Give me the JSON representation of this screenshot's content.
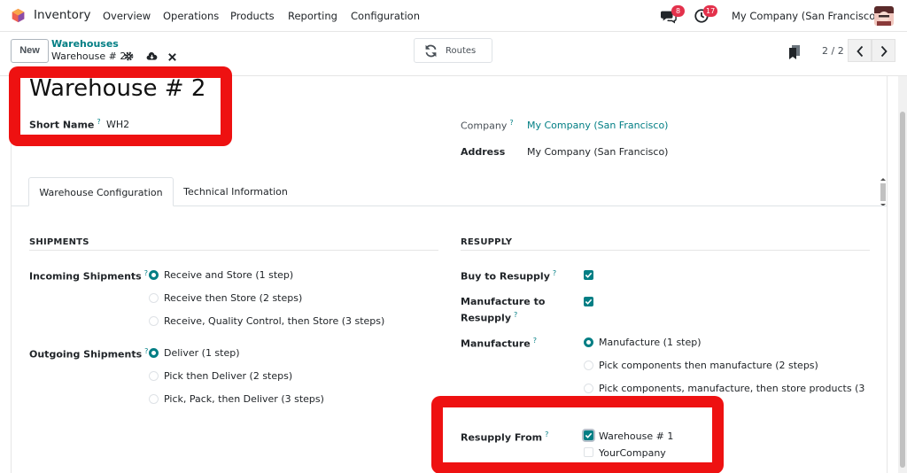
{
  "navbar": {
    "app_name": "Inventory",
    "menu": [
      "Overview",
      "Operations",
      "Products",
      "Reporting",
      "Configuration"
    ],
    "messages_count": "8",
    "activities_count": "17",
    "company": "My Company (San Francisco)"
  },
  "control_panel": {
    "new_label": "New",
    "breadcrumb_parent": "Warehouses",
    "breadcrumb_current": "Warehouse # 2",
    "routes_label": "Routes",
    "pager": "2 / 2"
  },
  "form": {
    "title": "Warehouse # 2",
    "short_name_label": "Short Name",
    "short_name_value": "WH2",
    "company_label": "Company",
    "company_value": "My Company (San Francisco)",
    "address_label": "Address",
    "address_value": "My Company (San Francisco)",
    "help_mark": "?"
  },
  "tabs": [
    "Warehouse Configuration",
    "Technical Information"
  ],
  "shipments": {
    "title": "SHIPMENTS",
    "incoming_label": "Incoming Shipments",
    "incoming_options": [
      "Receive and Store (1 step)",
      "Receive then Store (2 steps)",
      "Receive, Quality Control, then Store (3 steps)"
    ],
    "incoming_selected": 0,
    "outgoing_label": "Outgoing Shipments",
    "outgoing_options": [
      "Deliver (1 step)",
      "Pick then Deliver (2 steps)",
      "Pick, Pack, then Deliver (3 steps)"
    ],
    "outgoing_selected": 0
  },
  "resupply": {
    "title": "RESUPPLY",
    "buy_label": "Buy to Resupply",
    "buy_checked": true,
    "manufacture_to_label_1": "Manufacture to",
    "manufacture_to_label_2": "Resupply",
    "manufacture_to_checked": true,
    "manufacture_label": "Manufacture",
    "manufacture_options": [
      "Manufacture (1 step)",
      "Pick components then manufacture (2 steps)",
      "Pick components, manufacture, then store products (3"
    ],
    "manufacture_selected": 0,
    "resupply_from_label": "Resupply From",
    "resupply_from_options": [
      {
        "label": "Warehouse # 1",
        "checked": true
      },
      {
        "label": "YourCompany",
        "checked": false
      }
    ]
  },
  "colors": {
    "accent": "#017e84",
    "annotation": "#ee1111",
    "badge": "#e3314b"
  }
}
